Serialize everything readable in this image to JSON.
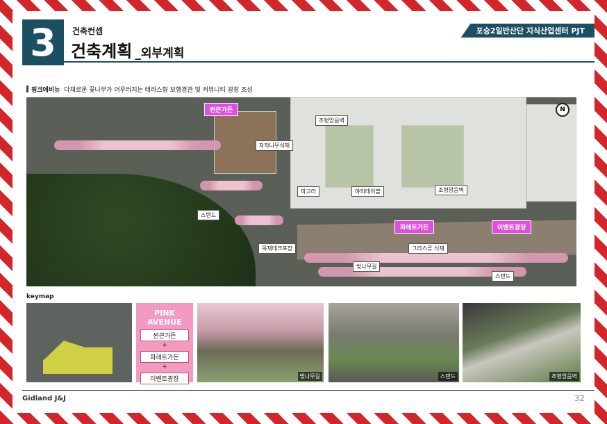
{
  "header": {
    "section_number": "3",
    "subtitle": "건축컨셉",
    "title": "건축계획",
    "title_sub": "_외부계획",
    "project_tag": "포승2일반산단 지식산업센터 PJT"
  },
  "section": {
    "label": "핑크에비뉴",
    "description": "다채로운 꽃나무가 어우러지는 테라스형 보행경관 및 커뮤니티 광장 조성"
  },
  "site_plan": {
    "north_mark": "N",
    "pink_tags": [
      "썬큰가든",
      "파레트가든",
      "이벤트광장"
    ],
    "callouts": [
      "조형앙음벽",
      "자작나무식재",
      "파고라",
      "야외테이블",
      "조형앙음벽",
      "스탠드",
      "목재데크포장",
      "그라스류 식재",
      "벚나무길",
      "스탠드"
    ]
  },
  "keymap": {
    "label": "keymap"
  },
  "pink_avenue": {
    "heading_line1": "PINK",
    "heading_line2": "AVENUE",
    "items": [
      "썬큰가든",
      "파레트가든",
      "이벤트광장"
    ],
    "plus": "+"
  },
  "photos": [
    {
      "caption": "벚나무길"
    },
    {
      "caption": "스탠드"
    },
    {
      "caption": "조형앙음벽"
    }
  ],
  "footer": {
    "company": "Gidland J&J",
    "page_number": "32"
  },
  "colors": {
    "accent": "#1d4f63",
    "pink": "#e04fe0",
    "pink_box": "#f29ac4",
    "border_red": "#d4262a"
  }
}
